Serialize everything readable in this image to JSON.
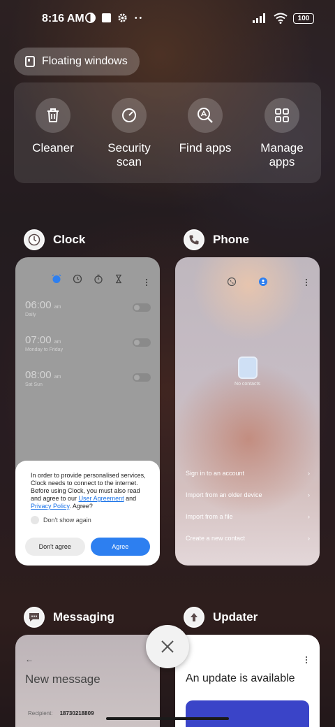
{
  "status_bar": {
    "time": "8:16 AM",
    "battery": "100"
  },
  "floating_windows": {
    "label": "Floating windows"
  },
  "quick_actions": [
    {
      "label": "Cleaner",
      "icon": "trash-icon"
    },
    {
      "label": "Security scan",
      "icon": "security-scan-icon"
    },
    {
      "label": "Find apps",
      "icon": "find-apps-icon"
    },
    {
      "label": "Manage apps",
      "icon": "grid-icon"
    }
  ],
  "apps": {
    "clock": {
      "title": "Clock",
      "alarms": [
        {
          "time": "06:00",
          "ampm": "am",
          "repeat": "Daily"
        },
        {
          "time": "07:00",
          "ampm": "am",
          "repeat": "Monday to Friday"
        },
        {
          "time": "08:00",
          "ampm": "am",
          "repeat": "Sat Sun"
        }
      ],
      "dialog": {
        "text_prefix": "In order to provide personalised services, Clock needs to connect to the internet. Before using Clock, you must also read and agree to our ",
        "link1": "User Agreement",
        "and": " and ",
        "link2": "Privacy Policy",
        "text_suffix": ". Agree?",
        "checkbox": "Don't show again",
        "decline": "Don't agree",
        "accept": "Agree"
      }
    },
    "phone": {
      "title": "Phone",
      "empty": "No contacts",
      "options": [
        "Sign in to an account",
        "Import from an older device",
        "Import from a file",
        "Create a new contact"
      ]
    },
    "messaging": {
      "title": "Messaging",
      "screen_title": "New message",
      "recipient_label": "Recipient:",
      "recipient_value": "18730218809"
    },
    "updater": {
      "title": "Updater",
      "headline": "An update is available"
    }
  },
  "colors": {
    "accent": "#2d7ff0",
    "updater_banner": "#3a44c8"
  }
}
